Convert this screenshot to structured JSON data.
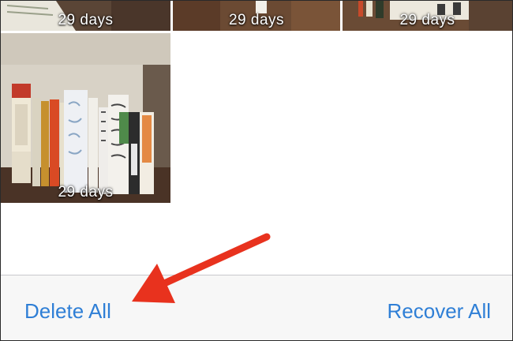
{
  "photos": [
    {
      "label": "29 days"
    },
    {
      "label": "29 days"
    },
    {
      "label": "29 days"
    },
    {
      "label": "29 days"
    }
  ],
  "toolbar": {
    "delete_label": "Delete All",
    "recover_label": "Recover All"
  },
  "colors": {
    "accent": "#2f7fd6",
    "annotation_arrow": "#e8321e"
  },
  "annotation": {
    "icon": "arrow-pointer-icon"
  }
}
